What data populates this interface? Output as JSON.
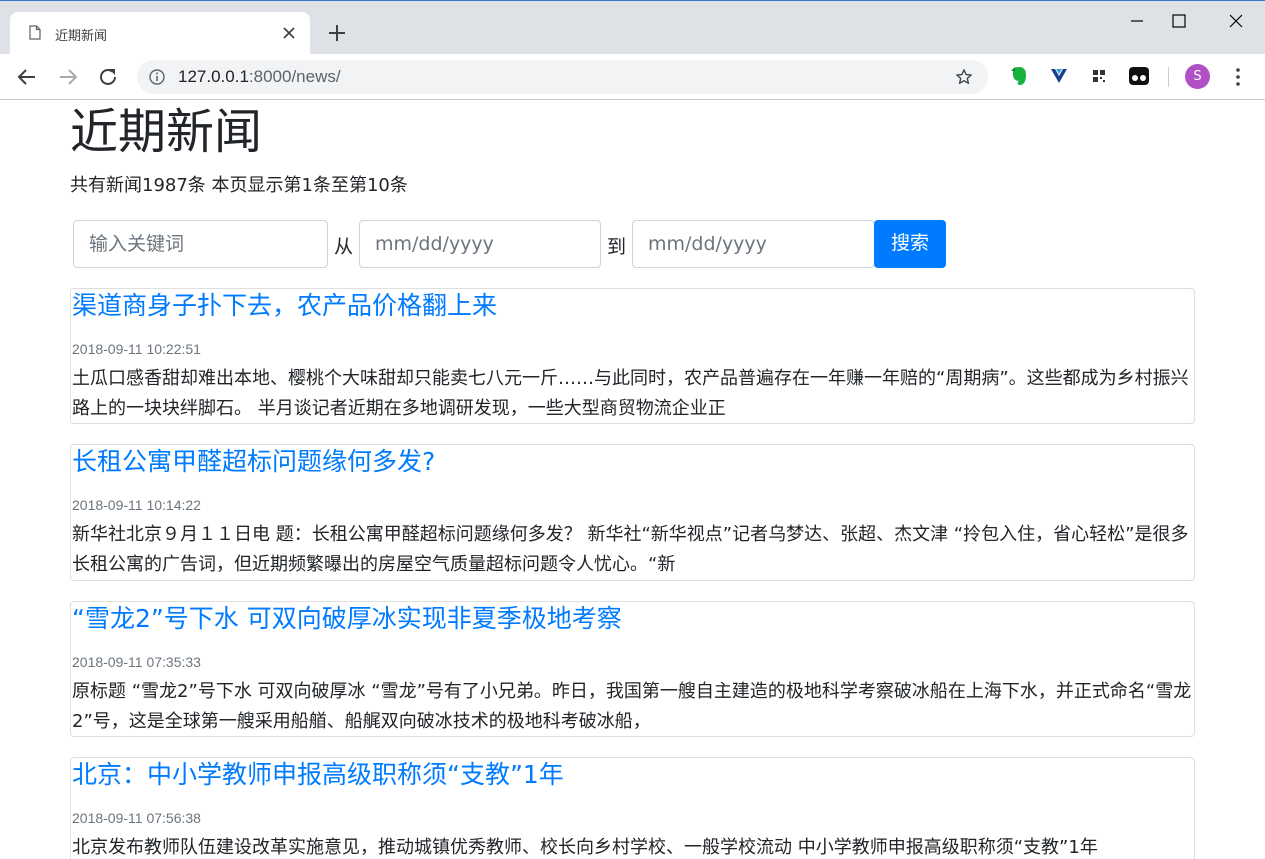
{
  "browser": {
    "tab_title": "近期新闻",
    "url_host": "127.0.0.1",
    "url_path": ":8000/news/",
    "profile_initial": "S",
    "icons": [
      "page-icon",
      "close-icon",
      "plus-icon",
      "minimize-icon",
      "maximize-icon",
      "window-close-icon",
      "back-icon",
      "forward-icon",
      "reload-icon",
      "info-icon",
      "star-icon",
      "evernote-icon",
      "extension-icon",
      "qr-icon",
      "tampermonkey-icon",
      "menu-icon"
    ]
  },
  "page": {
    "heading": "近期新闻",
    "summary": "共有新闻1987条 本页显示第1条至第10条",
    "search": {
      "keyword_placeholder": "输入关键词",
      "from_label": "从",
      "from_placeholder": "mm/dd/yyyy",
      "to_label": "到",
      "to_placeholder": "mm/dd/yyyy",
      "button_label": "搜索"
    },
    "colors": {
      "accent": "#007bff",
      "muted": "#6c757d"
    }
  },
  "news": [
    {
      "title": "渠道商身子扑下去，农产品价格翻上来",
      "date": "2018-09-11 10:22:51",
      "body": "土瓜口感香甜却难出本地、樱桃个大味甜却只能卖七八元一斤……与此同时，农产品普遍存在一年赚一年赔的“周期病”。这些都成为乡村振兴路上的一块块绊脚石。 半月谈记者近期在多地调研发现，一些大型商贸物流企业正"
    },
    {
      "title": "长租公寓甲醛超标问题缘何多发?",
      "date": "2018-09-11 10:14:22",
      "body": "新华社北京９月１１日电 题：长租公寓甲醛超标问题缘何多发？ 新华社“新华视点”记者乌梦达、张超、杰文津 “拎包入住，省心轻松”是很多长租公寓的广告词，但近期频繁曝出的房屋空气质量超标问题令人忧心。“新"
    },
    {
      "title": "“雪龙2”号下水 可双向破厚冰实现非夏季极地考察",
      "date": "2018-09-11 07:35:33",
      "body": "原标题 “雪龙2”号下水 可双向破厚冰 “雪龙”号有了小兄弟。昨日，我国第一艘自主建造的极地科学考察破冰船在上海下水，并正式命名“雪龙2”号，这是全球第一艘采用船艏、船艉双向破冰技术的极地科考破冰船，"
    },
    {
      "title": "北京：中小学教师申报高级职称须“支教”1年",
      "date": "2018-09-11 07:56:38",
      "body": "北京发布教师队伍建设改革实施意见，推动城镇优秀教师、校长向乡村学校、一般学校流动 中小学教师申报高级职称须“支教”1年"
    }
  ]
}
